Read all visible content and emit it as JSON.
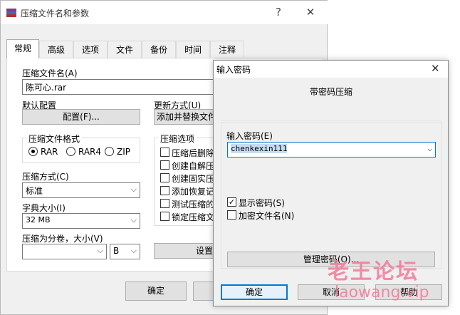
{
  "main_window": {
    "title": "压缩文件名和参数",
    "help_glyph": "?",
    "close_glyph": "✕",
    "tabs": [
      "常规",
      "高级",
      "选项",
      "文件",
      "备份",
      "时间",
      "注释"
    ],
    "archive_name_label": "压缩文件名(A)",
    "archive_name_value": "陈可心.rar",
    "default_config_label": "默认配置",
    "config_button": "配置(F)...",
    "update_mode_label": "更新方式(U)",
    "update_mode_value": "添加并替换文件",
    "format_group": "压缩文件格式",
    "formats": [
      "RAR",
      "RAR4",
      "ZIP"
    ],
    "selected_format": "RAR",
    "method_label": "压缩方式(C)",
    "method_value": "标准",
    "dict_label": "字典大小(I)",
    "dict_value": "32 MB",
    "split_label": "压缩为分卷，大小(V)",
    "split_value": "",
    "split_unit": "B",
    "options_group": "压缩选项",
    "options": [
      "压缩后删除",
      "创建自解压",
      "创建固实压",
      "添加恢复记",
      "测试压缩的",
      "锁定压缩文"
    ],
    "settings_button": "设置",
    "ok_button": "确定"
  },
  "password_dialog": {
    "title": "输入密码",
    "close_glyph": "✕",
    "heading": "带密码压缩",
    "password_label": "输入密码(E)",
    "password_value": "chenkexin111",
    "show_password_label": "显示密码(S)",
    "show_password_checked": true,
    "encrypt_names_label": "加密文件名(N)",
    "encrypt_names_checked": false,
    "manage_button": "管理密码(O)...",
    "ok_button": "确定",
    "cancel_button": "取消",
    "help_button": "帮助"
  },
  "watermark": {
    "title": "老王论坛",
    "url": "laowang.vip"
  },
  "colors": {
    "selection": "#c8dcf0",
    "focus_border": "#0078d7",
    "watermark": "#f07a9a"
  }
}
